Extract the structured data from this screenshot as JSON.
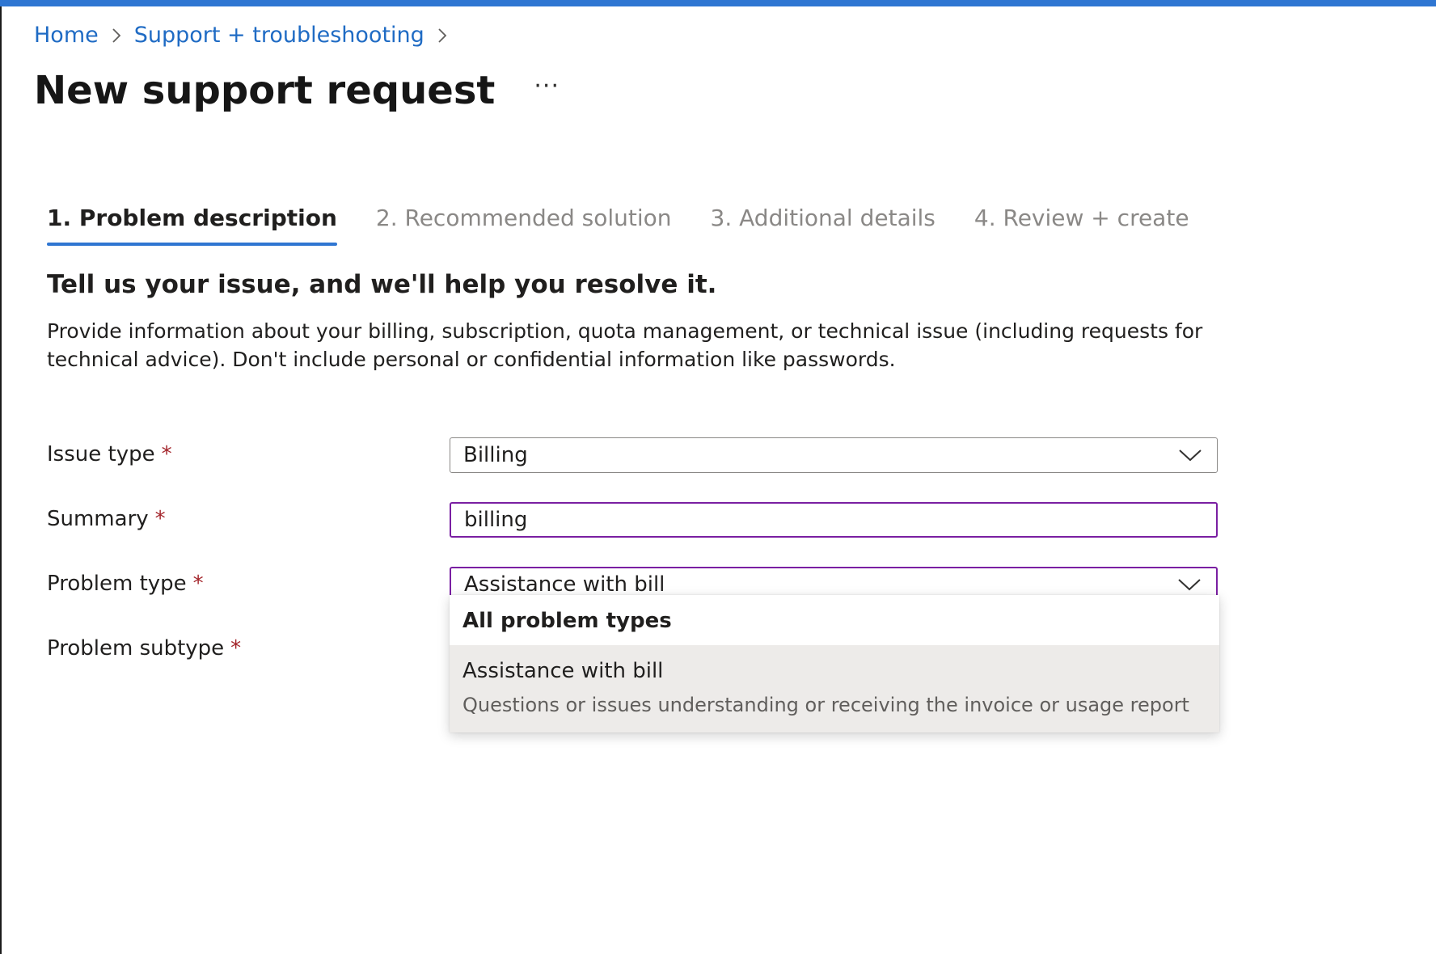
{
  "breadcrumb": {
    "home": "Home",
    "support": "Support + troubleshooting"
  },
  "header": {
    "title": "New support request",
    "more": "···"
  },
  "tabs": [
    {
      "label": "1. Problem description",
      "active": true
    },
    {
      "label": "2. Recommended solution",
      "active": false
    },
    {
      "label": "3. Additional details",
      "active": false
    },
    {
      "label": "4. Review + create",
      "active": false
    }
  ],
  "section": {
    "heading": "Tell us your issue, and we'll help you resolve it.",
    "description": "Provide information about your billing, subscription, quota management, or technical issue (including requests for technical advice). Don't include personal or confidential information like passwords."
  },
  "form": {
    "required_mark": "*",
    "issue_type": {
      "label": "Issue type",
      "value": "Billing"
    },
    "summary": {
      "label": "Summary",
      "value": "billing"
    },
    "problem_type": {
      "label": "Problem type",
      "value": "Assistance with bill"
    },
    "problem_subtype": {
      "label": "Problem subtype"
    }
  },
  "dropdown": {
    "group_header": "All problem types",
    "options": [
      {
        "title": "Assistance with bill",
        "description": "Questions or issues understanding or receiving the invoice or usage report"
      }
    ]
  },
  "colors": {
    "accent": "#2f76d2",
    "link": "#1f6bc4",
    "focus_border": "#7a1fa2",
    "required": "#a4262c"
  }
}
